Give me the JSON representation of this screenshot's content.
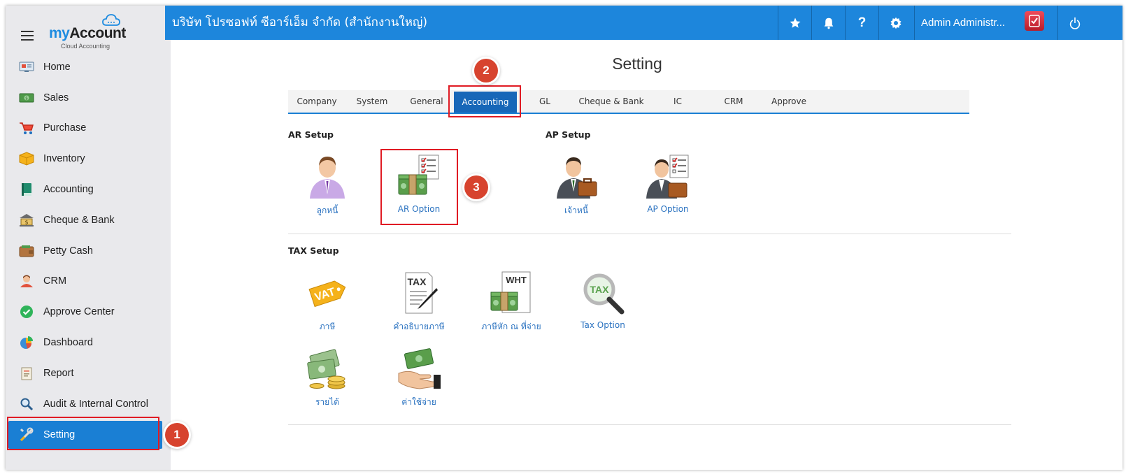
{
  "app": {
    "logo_my": "my",
    "logo_account": "Account",
    "logo_sub": "Cloud Accounting"
  },
  "sidebar": {
    "items": [
      {
        "label": "Home",
        "icon": "home-icon"
      },
      {
        "label": "Sales",
        "icon": "cash-icon"
      },
      {
        "label": "Purchase",
        "icon": "cart-icon"
      },
      {
        "label": "Inventory",
        "icon": "box-icon"
      },
      {
        "label": "Accounting",
        "icon": "book-icon"
      },
      {
        "label": "Cheque & Bank",
        "icon": "bank-icon"
      },
      {
        "label": "Petty Cash",
        "icon": "wallet-icon"
      },
      {
        "label": "CRM",
        "icon": "person-icon"
      },
      {
        "label": "Approve Center",
        "icon": "check-circle-icon"
      },
      {
        "label": "Dashboard",
        "icon": "pie-chart-icon"
      },
      {
        "label": "Report",
        "icon": "report-icon"
      },
      {
        "label": "Audit & Internal Control",
        "icon": "magnifier-icon"
      },
      {
        "label": "Setting",
        "icon": "tools-icon",
        "active": true
      }
    ]
  },
  "topbar": {
    "company": "บริษัท โปรซอฟท์ ซีอาร์เอ็ม จำกัด (สำนักงานใหญ่)",
    "user": "Admin Administr...",
    "help_label": "?"
  },
  "page": {
    "title": "Setting"
  },
  "tabs": [
    {
      "label": "Company"
    },
    {
      "label": "System"
    },
    {
      "label": "General"
    },
    {
      "label": "Accounting",
      "active": true
    },
    {
      "label": "GL"
    },
    {
      "label": "Cheque & Bank"
    },
    {
      "label": "IC"
    },
    {
      "label": "CRM"
    },
    {
      "label": "Approve"
    }
  ],
  "ar_setup": {
    "heading": "AR Setup",
    "items": [
      {
        "label": "ลูกหนี้",
        "icon": "customer-person-icon"
      },
      {
        "label": "AR Option",
        "icon": "money-checklist-icon"
      }
    ]
  },
  "ap_setup": {
    "heading": "AP Setup",
    "items": [
      {
        "label": "เจ้าหนี้",
        "icon": "supplier-briefcase-icon"
      },
      {
        "label": "AP Option",
        "icon": "supplier-checklist-icon"
      }
    ]
  },
  "tax_setup": {
    "heading": "TAX Setup",
    "items": [
      {
        "label": "ภาษี",
        "icon": "vat-tag-icon",
        "tag": "VAT"
      },
      {
        "label": "คำอธิบายภาษี",
        "icon": "tax-document-icon",
        "tag": "TAX"
      },
      {
        "label": "ภาษีหัก ณ ที่จ่าย",
        "icon": "wht-money-icon",
        "tag": "WHT"
      },
      {
        "label": "Tax Option",
        "icon": "tax-magnifier-icon",
        "tag": "TAX"
      },
      {
        "label": "รายได้",
        "icon": "income-money-icon"
      },
      {
        "label": "ค่าใช้จ่าย",
        "icon": "expense-hand-icon"
      }
    ]
  },
  "annotations": {
    "step1": "1",
    "step2": "2",
    "step3": "3"
  },
  "colors": {
    "primary": "#1d86dc",
    "active_tab": "#1767b8",
    "highlight": "#e01b24",
    "badge": "#d7432e",
    "link": "#2a72c0"
  }
}
